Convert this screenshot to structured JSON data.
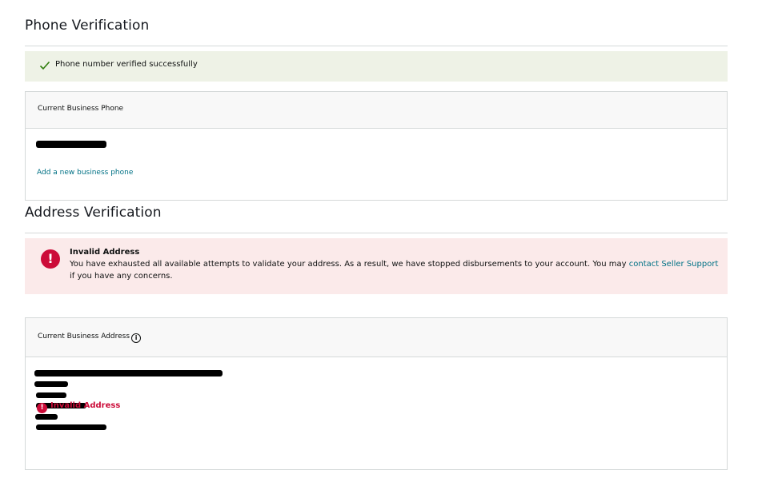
{
  "phone_section": {
    "title": "Phone Verification",
    "success_message": "Phone number verified successfully",
    "card_header": "Current Business Phone",
    "add_link": "Add a new business phone"
  },
  "address_section": {
    "title": "Address Verification",
    "error_title": "Invalid Address",
    "error_body": "You have exhausted all available attempts to validate your address. As a result, we have stopped disbursements to your account. You may",
    "error_link": "contact Seller Support",
    "error_tail": "if you have any concerns.",
    "card_header": "Current Business Address",
    "invalid_label": "Invalid Address"
  },
  "icons": {
    "success": "check-icon",
    "error": "exclamation-circle-icon",
    "info": "info-circle-icon"
  },
  "colors": {
    "success_bg": "#eef2e6",
    "error_bg": "#fbeaea",
    "error_red": "#cc0c39",
    "link": "#007185"
  }
}
